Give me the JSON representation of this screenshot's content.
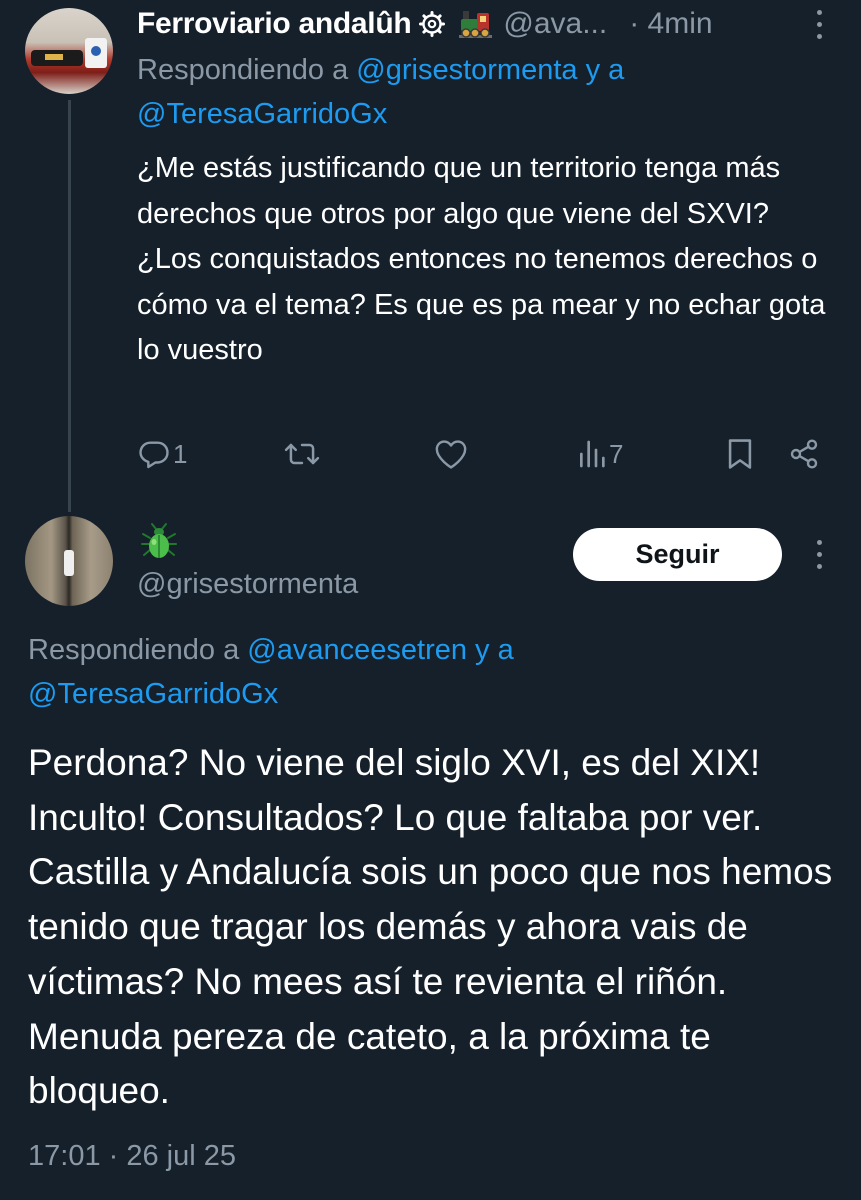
{
  "tweet1": {
    "display_name": "Ferroviario andalûh",
    "badge_icon": "gear-badge-icon",
    "emoji_icon": "locomotive-icon",
    "handle": "@ava...",
    "time": "· 4min",
    "reply_prefix": "Respondiendo a",
    "reply_mention_1": "@grisestormenta",
    "reply_connector": "y a",
    "reply_mention_2": "@TeresaGarridoGx",
    "text": "¿Me estás justificando que un territorio tenga más derechos que otros por algo que viene del SXVI? ¿Los conquistados entonces no tenemos derechos o cómo va el tema? Es que es pa mear y no echar gota lo vuestro",
    "actions": {
      "reply_count": "1",
      "retweet_count": "",
      "like_count": "",
      "views_count": "7"
    }
  },
  "tweet2": {
    "emoji_icon": "beetle-icon",
    "handle": "@grisestormenta",
    "follow_label": "Seguir",
    "reply_prefix": "Respondiendo a",
    "reply_mention_1": "@avanceesetren",
    "reply_connector": "y a",
    "reply_mention_2": "@TeresaGarridoGx",
    "text": "Perdona? No viene del siglo XVI, es del XIX! Inculto! Consultados? Lo que faltaba por ver. Castilla y Andalucía sois un poco que nos hemos tenido que tragar los demás y ahora vais de víctimas? No mees así te revienta el riñón. Menuda pereza de cateto, a la próxima te bloqueo.",
    "timestamp": "17:01 · 26 jul 25"
  },
  "colors": {
    "background": "#15202b",
    "text_primary": "#ffffff",
    "text_secondary": "#8b98a5",
    "accent": "#1d9bf0",
    "thread_line": "#38444d"
  }
}
